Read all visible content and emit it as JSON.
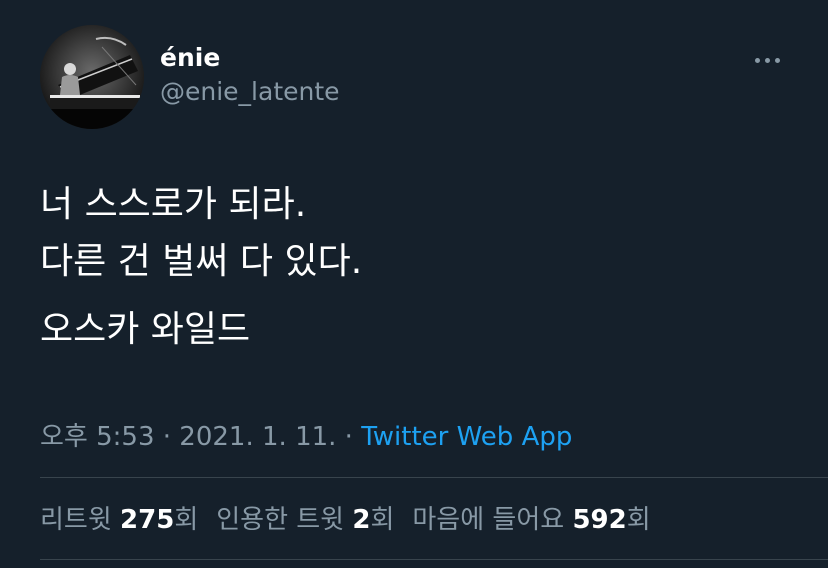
{
  "author": {
    "display_name": "énie",
    "handle": "@enie_latente"
  },
  "tweet": {
    "lines": [
      "너 스스로가 되라.",
      "다른 건 벌써 다 있다.",
      "오스카 와일드"
    ]
  },
  "meta": {
    "time": "오후 5:53",
    "sep1": " · ",
    "date": "2021. 1. 11.",
    "sep2": " · ",
    "source": "Twitter Web App"
  },
  "stats": {
    "retweets_label": "리트윗 ",
    "retweets_count": "275",
    "retweets_suffix": "회",
    "quotes_label": "인용한 트윗 ",
    "quotes_count": "2",
    "quotes_suffix": "회",
    "likes_label": "마음에 들어요 ",
    "likes_count": "592",
    "likes_suffix": "회"
  },
  "colors": {
    "background": "#15202b",
    "secondary_text": "#8899a6",
    "link": "#1da1f2",
    "divider": "#38444d"
  },
  "icons": {
    "more": "more-horizontal-icon"
  }
}
